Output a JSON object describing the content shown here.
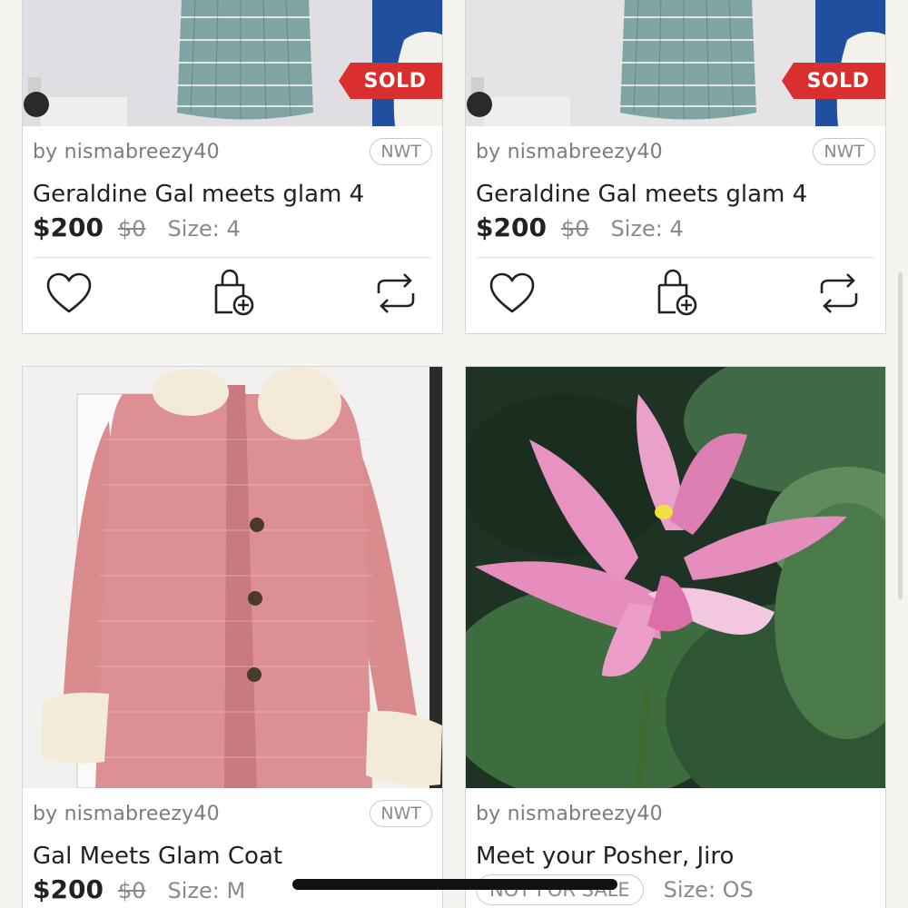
{
  "listings": [
    {
      "seller": "by nismabreezy40",
      "condition": "NWT",
      "title": "Geraldine Gal meets glam 4",
      "price": "$200",
      "original_price": "$0",
      "size": "Size: 4",
      "status_ribbon": "SOLD"
    },
    {
      "seller": "by nismabreezy40",
      "condition": "NWT",
      "title": "Geraldine Gal meets glam 4",
      "price": "$200",
      "original_price": "$0",
      "size": "Size: 4",
      "status_ribbon": "SOLD"
    },
    {
      "seller": "by nismabreezy40",
      "condition": "NWT",
      "title": "Gal Meets Glam Coat",
      "price": "$200",
      "original_price": "$0",
      "size": "Size: M"
    },
    {
      "seller": "by nismabreezy40",
      "title": "Meet your Posher, Jiro",
      "availability": "NOT FOR SALE",
      "size": "Size: OS"
    }
  ],
  "icons": [
    "heart-icon",
    "bag-add-icon",
    "share-repost-icon"
  ],
  "colors": {
    "sold_ribbon": "#d9302f",
    "card_bg": "#ffffff",
    "page_bg": "#f5f4f0"
  }
}
